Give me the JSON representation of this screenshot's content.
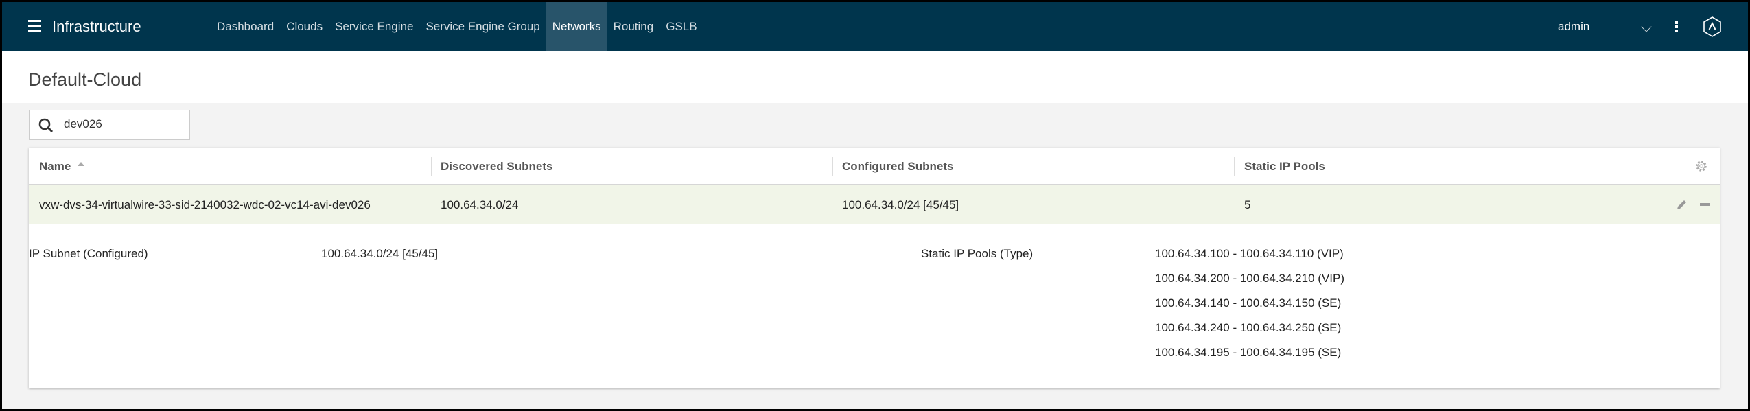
{
  "header": {
    "app_title": "Infrastructure",
    "nav": [
      {
        "label": "Dashboard"
      },
      {
        "label": "Clouds"
      },
      {
        "label": "Service Engine"
      },
      {
        "label": "Service Engine Group"
      },
      {
        "label": "Networks",
        "active": true
      },
      {
        "label": "Routing"
      },
      {
        "label": "GSLB"
      }
    ],
    "user": "admin"
  },
  "page": {
    "title": "Default-Cloud"
  },
  "search": {
    "value": "dev026"
  },
  "table": {
    "columns": [
      "Name",
      "Discovered Subnets",
      "Configured Subnets",
      "Static IP Pools"
    ],
    "sort": {
      "column": "Name",
      "direction": "ascending"
    },
    "rows": [
      {
        "name": "vxw-dvs-34-virtualwire-33-sid-2140032-wdc-02-vc14-avi-dev026",
        "discovered": "100.64.34.0/24",
        "configured": "100.64.34.0/24 [45/45]",
        "static_pools": "5"
      }
    ],
    "expanded": {
      "subnet_label": "IP Subnet (Configured)",
      "subnet_value": "100.64.34.0/24 [45/45]",
      "pools_label": "Static IP Pools (Type)",
      "pools": [
        "100.64.34.100 - 100.64.34.110 (VIP)",
        "100.64.34.200 - 100.64.34.210 (VIP)",
        "100.64.34.140 - 100.64.34.150 (SE)",
        "100.64.34.240 - 100.64.34.250 (SE)",
        "100.64.34.195 - 100.64.34.195 (SE)"
      ]
    }
  },
  "colors": {
    "header_bg": "#00354d",
    "active_tab": "#28546a",
    "selected_row": "#f1f5e8"
  }
}
